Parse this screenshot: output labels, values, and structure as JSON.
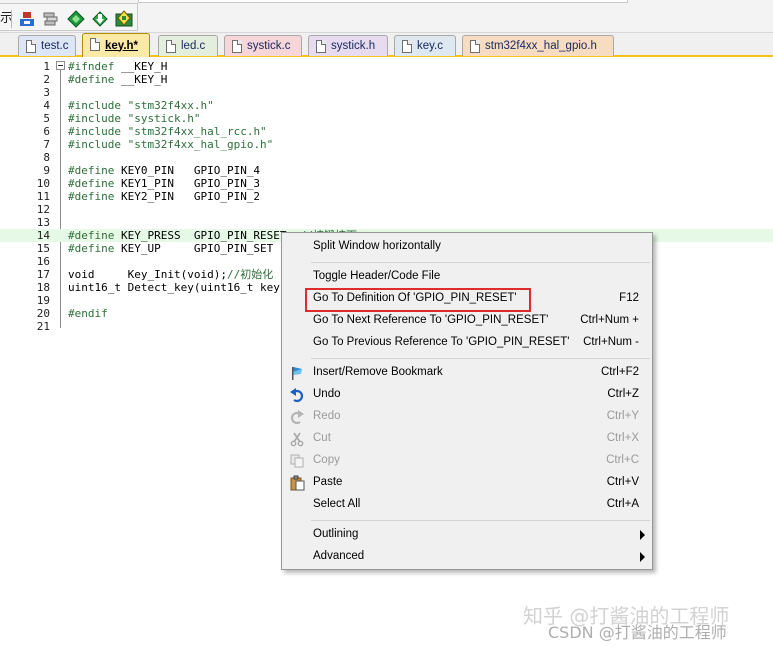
{
  "toolbar": {
    "cut_glyph": "示",
    "buttons": [
      "debug-icon",
      "stack-icon",
      "green-diamond-icon",
      "download-icon",
      "target-icon"
    ]
  },
  "tabs": [
    {
      "label": "test.c",
      "color": "#dce6f4"
    },
    {
      "label": "key.h*",
      "color": "#fbe9a6",
      "active": true
    },
    {
      "label": "led.c",
      "color": "#e3efdc"
    },
    {
      "label": "systick.c",
      "color": "#f6d6d9"
    },
    {
      "label": "systick.h",
      "color": "#e6dbef"
    },
    {
      "label": "key.c",
      "color": "#dde8f0"
    },
    {
      "label": "stm32f4xx_hal_gpio.h",
      "color": "#f7dcc2"
    }
  ],
  "editor": {
    "lines": [
      {
        "n": "1",
        "parts": [
          {
            "t": "#ifndef ",
            "c": "pp"
          },
          {
            "t": "__KEY_H",
            "c": "plain"
          }
        ]
      },
      {
        "n": "2",
        "parts": [
          {
            "t": "#define ",
            "c": "pp"
          },
          {
            "t": "__KEY_H",
            "c": "plain"
          }
        ]
      },
      {
        "n": "3",
        "parts": []
      },
      {
        "n": "4",
        "parts": [
          {
            "t": "#include ",
            "c": "pp"
          },
          {
            "t": "\"stm32f4xx.h\"",
            "c": "str"
          }
        ]
      },
      {
        "n": "5",
        "parts": [
          {
            "t": "#include ",
            "c": "pp"
          },
          {
            "t": "\"systick.h\"",
            "c": "str"
          }
        ]
      },
      {
        "n": "6",
        "parts": [
          {
            "t": "#include ",
            "c": "pp"
          },
          {
            "t": "\"stm32f4xx_hal_rcc.h\"",
            "c": "str"
          }
        ]
      },
      {
        "n": "7",
        "parts": [
          {
            "t": "#include ",
            "c": "pp"
          },
          {
            "t": "\"stm32f4xx_hal_gpio.h\"",
            "c": "str"
          }
        ]
      },
      {
        "n": "8",
        "parts": []
      },
      {
        "n": "9",
        "parts": [
          {
            "t": "#define ",
            "c": "pp"
          },
          {
            "t": "KEY0_PIN   GPIO_PIN_4",
            "c": "plain"
          }
        ]
      },
      {
        "n": "10",
        "parts": [
          {
            "t": "#define ",
            "c": "pp"
          },
          {
            "t": "KEY1_PIN   GPIO_PIN_3",
            "c": "plain"
          }
        ]
      },
      {
        "n": "11",
        "parts": [
          {
            "t": "#define ",
            "c": "pp"
          },
          {
            "t": "KEY2_PIN   GPIO_PIN_2",
            "c": "plain"
          }
        ]
      },
      {
        "n": "12",
        "parts": []
      },
      {
        "n": "13",
        "parts": []
      },
      {
        "n": "14",
        "parts": [
          {
            "t": "#define ",
            "c": "pp"
          },
          {
            "t": "KEY_PRESS  GPIO_PIN_RESET",
            "c": "plain"
          },
          {
            "t": "  //按键按下",
            "c": "cmt"
          }
        ],
        "highlight": true
      },
      {
        "n": "15",
        "parts": [
          {
            "t": "#define ",
            "c": "pp"
          },
          {
            "t": "KEY_UP     GPIO_PIN_SET",
            "c": "plain"
          }
        ]
      },
      {
        "n": "16",
        "parts": []
      },
      {
        "n": "17",
        "parts": [
          {
            "t": "void     Key_Init(void);",
            "c": "plain"
          },
          {
            "t": "//初始化",
            "c": "cmt"
          }
        ]
      },
      {
        "n": "18",
        "parts": [
          {
            "t": "uint16_t Detect_key(uint16_t key",
            "c": "plain"
          }
        ]
      },
      {
        "n": "19",
        "parts": []
      },
      {
        "n": "20",
        "parts": [
          {
            "t": "#endif",
            "c": "pp"
          }
        ]
      },
      {
        "n": "21",
        "parts": []
      }
    ]
  },
  "context_menu": {
    "items": [
      {
        "label": "Split Window horizontally",
        "shortcut": ""
      },
      {
        "sep": true
      },
      {
        "label": "Toggle Header/Code File",
        "shortcut": ""
      },
      {
        "label": "Go To Definition Of 'GPIO_PIN_RESET'",
        "shortcut": "F12",
        "boxed": true
      },
      {
        "label": "Go To Next Reference To 'GPIO_PIN_RESET'",
        "shortcut": "Ctrl+Num +"
      },
      {
        "label": "Go To Previous Reference To 'GPIO_PIN_RESET'",
        "shortcut": "Ctrl+Num -"
      },
      {
        "sep": true
      },
      {
        "label": "Insert/Remove Bookmark",
        "shortcut": "Ctrl+F2",
        "icon": "bookmark-flag-icon"
      },
      {
        "label": "Undo",
        "shortcut": "Ctrl+Z",
        "icon": "undo-icon"
      },
      {
        "label": "Redo",
        "shortcut": "Ctrl+Y",
        "icon": "redo-icon",
        "disabled": true
      },
      {
        "label": "Cut",
        "shortcut": "Ctrl+X",
        "icon": "scissors-icon",
        "disabled": true
      },
      {
        "label": "Copy",
        "shortcut": "Ctrl+C",
        "icon": "copy-icon",
        "disabled": true
      },
      {
        "label": "Paste",
        "shortcut": "Ctrl+V",
        "icon": "paste-icon"
      },
      {
        "label": "Select All",
        "shortcut": "Ctrl+A"
      },
      {
        "sep": true
      },
      {
        "label": "Outlining",
        "shortcut": "",
        "submenu": true
      },
      {
        "label": "Advanced",
        "shortcut": "",
        "submenu": true
      }
    ]
  },
  "watermark": {
    "line1": "知乎 @打酱油的工程师",
    "line2": "CSDN @打酱油的工程师"
  },
  "colors": {
    "highlight": "#e6f9e6",
    "active_tab": "#fbe9a6",
    "tab_underline": "#f5c21b",
    "menu_bg": "#f0f0f0",
    "red_box": "#e02b2b",
    "preprocessor": "#2e6f3a"
  }
}
